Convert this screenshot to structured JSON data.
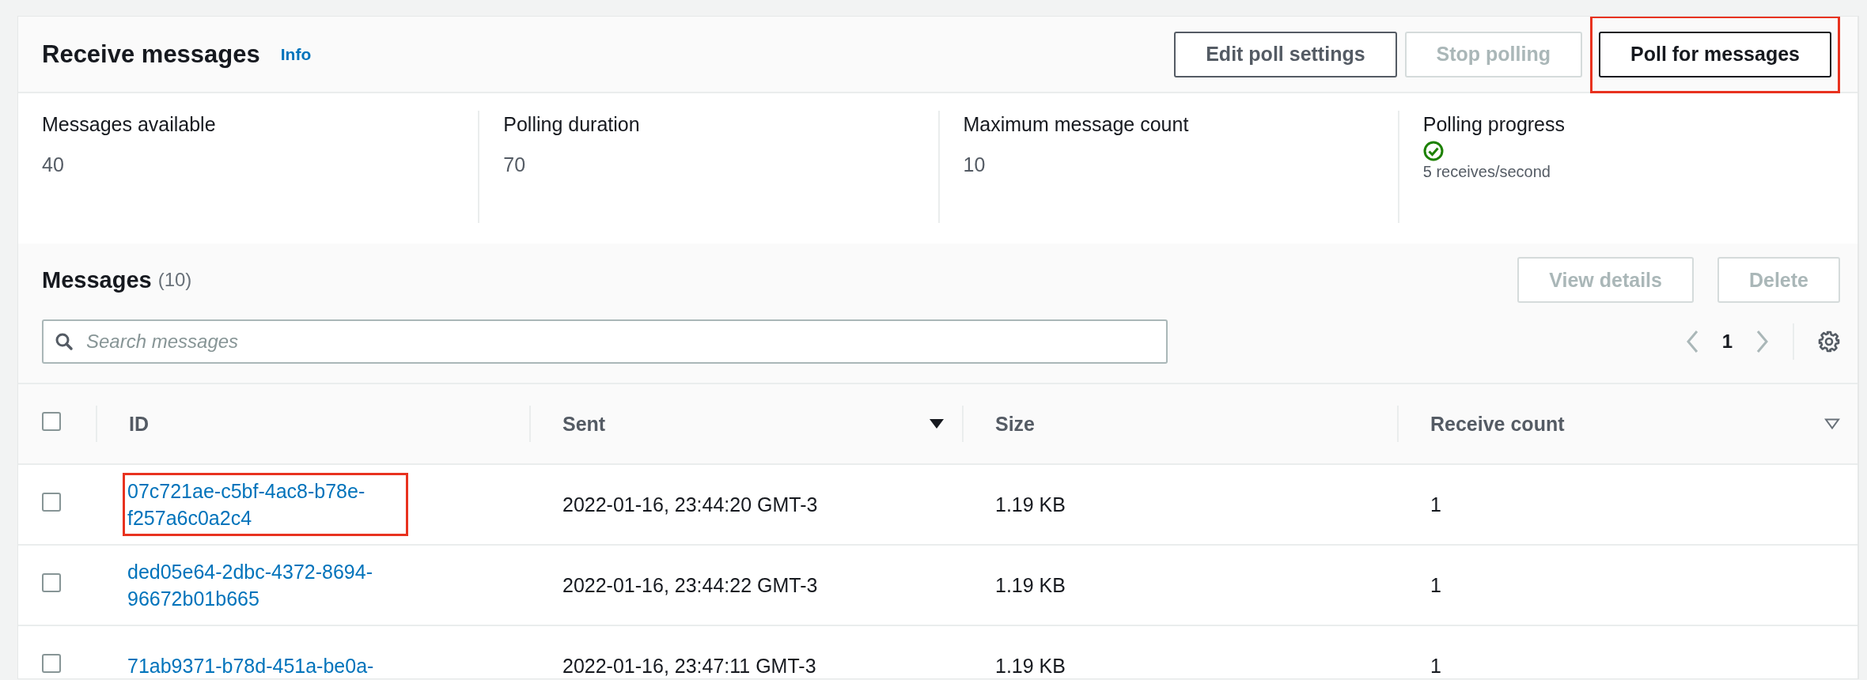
{
  "panel": {
    "title": "Receive messages",
    "info_link": "Info",
    "buttons": [
      {
        "label": "Edit poll settings",
        "disabled": false,
        "highlighted": false
      },
      {
        "label": "Stop polling",
        "disabled": true,
        "highlighted": false
      },
      {
        "label": "Poll for messages",
        "disabled": false,
        "highlighted": true
      }
    ]
  },
  "stats": [
    {
      "kind": "text",
      "label": "Messages available",
      "value": "40"
    },
    {
      "kind": "text",
      "label": "Polling duration",
      "value": "70"
    },
    {
      "kind": "text",
      "label": "Maximum message count",
      "value": "10"
    },
    {
      "kind": "status",
      "label": "Polling progress",
      "value": "5 receives/second"
    }
  ],
  "messages": {
    "title": "Messages",
    "count": "(10)",
    "buttons": [
      {
        "label": "View details",
        "disabled": true
      },
      {
        "label": "Delete",
        "disabled": true
      }
    ],
    "search": {
      "placeholder": "Search messages"
    },
    "pagination": {
      "page": "1"
    },
    "table": {
      "all_checked": false,
      "columns": [
        {
          "label": "ID",
          "sortable": false,
          "sorted": false
        },
        {
          "label": "Sent",
          "sortable": true,
          "sorted": true
        },
        {
          "label": "Size",
          "sortable": false,
          "sorted": false
        },
        {
          "label": "Receive count",
          "sortable": true,
          "sorted": false
        }
      ],
      "rows": [
        {
          "checked": false,
          "highlighted": true,
          "cells": [
            "07c721ae-c5bf-4ac8-b78e-f257a6c0a2c4",
            "2022-01-16, 23:44:20 GMT-3",
            "1.19 KB",
            "1"
          ]
        },
        {
          "checked": false,
          "highlighted": false,
          "cells": [
            "ded05e64-2dbc-4372-8694-96672b01b665",
            "2022-01-16, 23:44:22 GMT-3",
            "1.19 KB",
            "1"
          ]
        },
        {
          "checked": false,
          "highlighted": false,
          "cells": [
            "71ab9371-b78d-451a-be0a-",
            "2022-01-16, 23:47:11 GMT-3",
            "1.19 KB",
            "1"
          ]
        }
      ]
    }
  }
}
